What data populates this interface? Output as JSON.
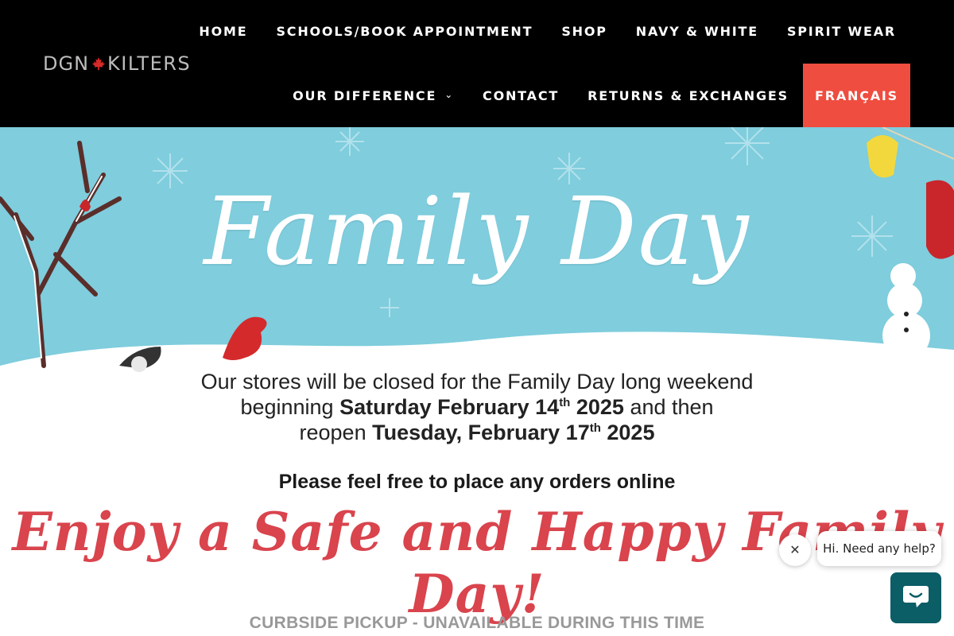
{
  "header": {
    "logo_left": "DGN",
    "logo_right": "KILTERS",
    "nav_row1": [
      "HOME",
      "SCHOOLS/BOOK APPOINTMENT",
      "SHOP",
      "NAVY & WHITE",
      "SPIRIT WEAR"
    ],
    "nav_row2": {
      "our_difference": "OUR DIFFERENCE",
      "contact": "CONTACT",
      "returns": "RETURNS & EXCHANGES",
      "francais": "FRANÇAIS"
    },
    "chevron_icon": "chevron-down-icon",
    "accent_color": "#ef4d3f"
  },
  "banner": {
    "headline": "Family Day",
    "line1": "Our stores will be closed for the Family Day long weekend",
    "line2_pre": "beginning ",
    "line2_bold": "Saturday February 14",
    "line2_sup": "th",
    "line2_bold2": " 2025",
    "line2_post": " and then",
    "line3_pre": "reopen ",
    "line3_bold": "Tuesday, February 17",
    "line3_sup": "th",
    "line3_bold2": " 2025",
    "online": "Please feel free to place any orders online",
    "enjoy": "Enjoy a Safe and Happy Family Day!",
    "curbside": "CURBSIDE PICKUP - UNAVAILABLE DURING THIS TIME",
    "sky_color": "#7fcddd",
    "script_color": "#d9444d"
  },
  "chat": {
    "bubble_text": "Hi. Need any help?",
    "close_icon": "close-icon",
    "chat_icon": "chat-icon",
    "button_color": "#0b5d66"
  }
}
